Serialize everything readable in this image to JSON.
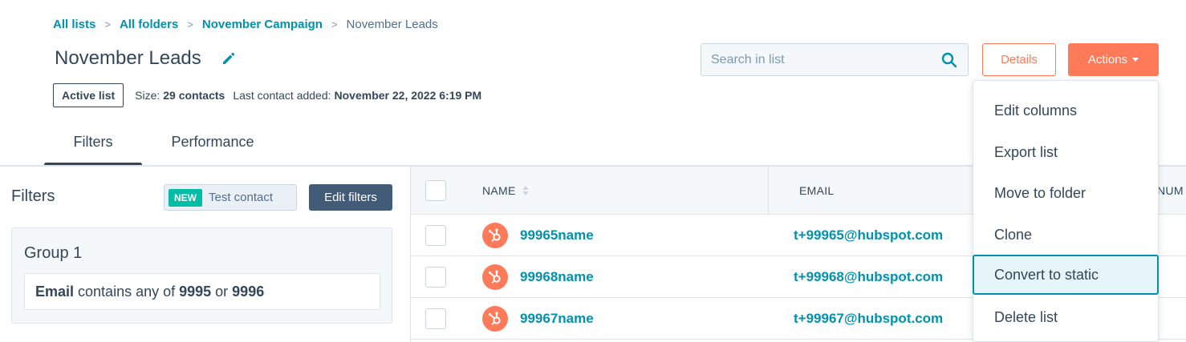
{
  "breadcrumb": {
    "items": [
      "All lists",
      "All folders",
      "November Campaign"
    ],
    "current": "November Leads",
    "separator": ">"
  },
  "header": {
    "title": "November Leads",
    "active_badge": "Active list",
    "size_label": "Size:",
    "size_value": "29 contacts",
    "last_added_label": "Last contact added:",
    "last_added_value": "November 22, 2022 6:19 PM"
  },
  "search": {
    "placeholder": "Search in list"
  },
  "buttons": {
    "details": "Details",
    "actions": "Actions"
  },
  "tabs": [
    {
      "label": "Filters",
      "active": true
    },
    {
      "label": "Performance",
      "active": false
    }
  ],
  "filters_panel": {
    "heading": "Filters",
    "new_badge": "NEW",
    "test_contact": "Test contact",
    "edit_filters": "Edit filters",
    "group_title": "Group 1",
    "rule": {
      "property": "Email",
      "operator": "contains any of",
      "value1": "9995",
      "conjunction": "or",
      "value2": "9996"
    }
  },
  "table": {
    "columns": [
      "NAME",
      "EMAIL",
      "NUM"
    ],
    "rows": [
      {
        "name": "99965name",
        "email": "t+99965@hubspot.com"
      },
      {
        "name": "99968name",
        "email": "t+99968@hubspot.com"
      },
      {
        "name": "99967name",
        "email": "t+99967@hubspot.com"
      }
    ]
  },
  "actions_menu": {
    "items": [
      "Edit columns",
      "Export list",
      "Move to folder",
      "Clone",
      "Convert to static",
      "Delete list"
    ],
    "highlighted_index": 4
  },
  "colors": {
    "accent": "#ff7a59",
    "link": "#0091ae",
    "text": "#33475b",
    "new_badge": "#00bda5",
    "dark_button": "#425b76"
  },
  "icons": {
    "edit": "pencil-icon",
    "search": "magnifier-icon",
    "sort": "sort-icon",
    "avatar": "hubspot-sprocket-icon"
  }
}
